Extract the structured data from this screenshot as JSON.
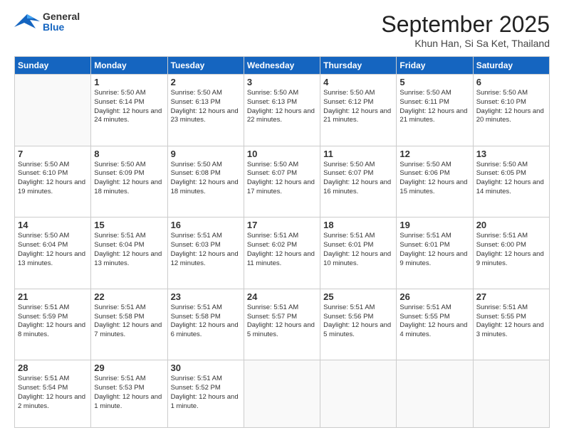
{
  "header": {
    "logo": {
      "general": "General",
      "blue": "Blue"
    },
    "title": "September 2025",
    "location": "Khun Han, Si Sa Ket, Thailand"
  },
  "weekdays": [
    "Sunday",
    "Monday",
    "Tuesday",
    "Wednesday",
    "Thursday",
    "Friday",
    "Saturday"
  ],
  "weeks": [
    [
      {
        "day": "",
        "info": ""
      },
      {
        "day": "1",
        "info": "Sunrise: 5:50 AM\nSunset: 6:14 PM\nDaylight: 12 hours\nand 24 minutes."
      },
      {
        "day": "2",
        "info": "Sunrise: 5:50 AM\nSunset: 6:13 PM\nDaylight: 12 hours\nand 23 minutes."
      },
      {
        "day": "3",
        "info": "Sunrise: 5:50 AM\nSunset: 6:13 PM\nDaylight: 12 hours\nand 22 minutes."
      },
      {
        "day": "4",
        "info": "Sunrise: 5:50 AM\nSunset: 6:12 PM\nDaylight: 12 hours\nand 21 minutes."
      },
      {
        "day": "5",
        "info": "Sunrise: 5:50 AM\nSunset: 6:11 PM\nDaylight: 12 hours\nand 21 minutes."
      },
      {
        "day": "6",
        "info": "Sunrise: 5:50 AM\nSunset: 6:10 PM\nDaylight: 12 hours\nand 20 minutes."
      }
    ],
    [
      {
        "day": "7",
        "info": "Sunrise: 5:50 AM\nSunset: 6:10 PM\nDaylight: 12 hours\nand 19 minutes."
      },
      {
        "day": "8",
        "info": "Sunrise: 5:50 AM\nSunset: 6:09 PM\nDaylight: 12 hours\nand 18 minutes."
      },
      {
        "day": "9",
        "info": "Sunrise: 5:50 AM\nSunset: 6:08 PM\nDaylight: 12 hours\nand 18 minutes."
      },
      {
        "day": "10",
        "info": "Sunrise: 5:50 AM\nSunset: 6:07 PM\nDaylight: 12 hours\nand 17 minutes."
      },
      {
        "day": "11",
        "info": "Sunrise: 5:50 AM\nSunset: 6:07 PM\nDaylight: 12 hours\nand 16 minutes."
      },
      {
        "day": "12",
        "info": "Sunrise: 5:50 AM\nSunset: 6:06 PM\nDaylight: 12 hours\nand 15 minutes."
      },
      {
        "day": "13",
        "info": "Sunrise: 5:50 AM\nSunset: 6:05 PM\nDaylight: 12 hours\nand 14 minutes."
      }
    ],
    [
      {
        "day": "14",
        "info": "Sunrise: 5:50 AM\nSunset: 6:04 PM\nDaylight: 12 hours\nand 13 minutes."
      },
      {
        "day": "15",
        "info": "Sunrise: 5:51 AM\nSunset: 6:04 PM\nDaylight: 12 hours\nand 13 minutes."
      },
      {
        "day": "16",
        "info": "Sunrise: 5:51 AM\nSunset: 6:03 PM\nDaylight: 12 hours\nand 12 minutes."
      },
      {
        "day": "17",
        "info": "Sunrise: 5:51 AM\nSunset: 6:02 PM\nDaylight: 12 hours\nand 11 minutes."
      },
      {
        "day": "18",
        "info": "Sunrise: 5:51 AM\nSunset: 6:01 PM\nDaylight: 12 hours\nand 10 minutes."
      },
      {
        "day": "19",
        "info": "Sunrise: 5:51 AM\nSunset: 6:01 PM\nDaylight: 12 hours\nand 9 minutes."
      },
      {
        "day": "20",
        "info": "Sunrise: 5:51 AM\nSunset: 6:00 PM\nDaylight: 12 hours\nand 9 minutes."
      }
    ],
    [
      {
        "day": "21",
        "info": "Sunrise: 5:51 AM\nSunset: 5:59 PM\nDaylight: 12 hours\nand 8 minutes."
      },
      {
        "day": "22",
        "info": "Sunrise: 5:51 AM\nSunset: 5:58 PM\nDaylight: 12 hours\nand 7 minutes."
      },
      {
        "day": "23",
        "info": "Sunrise: 5:51 AM\nSunset: 5:58 PM\nDaylight: 12 hours\nand 6 minutes."
      },
      {
        "day": "24",
        "info": "Sunrise: 5:51 AM\nSunset: 5:57 PM\nDaylight: 12 hours\nand 5 minutes."
      },
      {
        "day": "25",
        "info": "Sunrise: 5:51 AM\nSunset: 5:56 PM\nDaylight: 12 hours\nand 5 minutes."
      },
      {
        "day": "26",
        "info": "Sunrise: 5:51 AM\nSunset: 5:55 PM\nDaylight: 12 hours\nand 4 minutes."
      },
      {
        "day": "27",
        "info": "Sunrise: 5:51 AM\nSunset: 5:55 PM\nDaylight: 12 hours\nand 3 minutes."
      }
    ],
    [
      {
        "day": "28",
        "info": "Sunrise: 5:51 AM\nSunset: 5:54 PM\nDaylight: 12 hours\nand 2 minutes."
      },
      {
        "day": "29",
        "info": "Sunrise: 5:51 AM\nSunset: 5:53 PM\nDaylight: 12 hours\nand 1 minute."
      },
      {
        "day": "30",
        "info": "Sunrise: 5:51 AM\nSunset: 5:52 PM\nDaylight: 12 hours\nand 1 minute."
      },
      {
        "day": "",
        "info": ""
      },
      {
        "day": "",
        "info": ""
      },
      {
        "day": "",
        "info": ""
      },
      {
        "day": "",
        "info": ""
      }
    ]
  ]
}
